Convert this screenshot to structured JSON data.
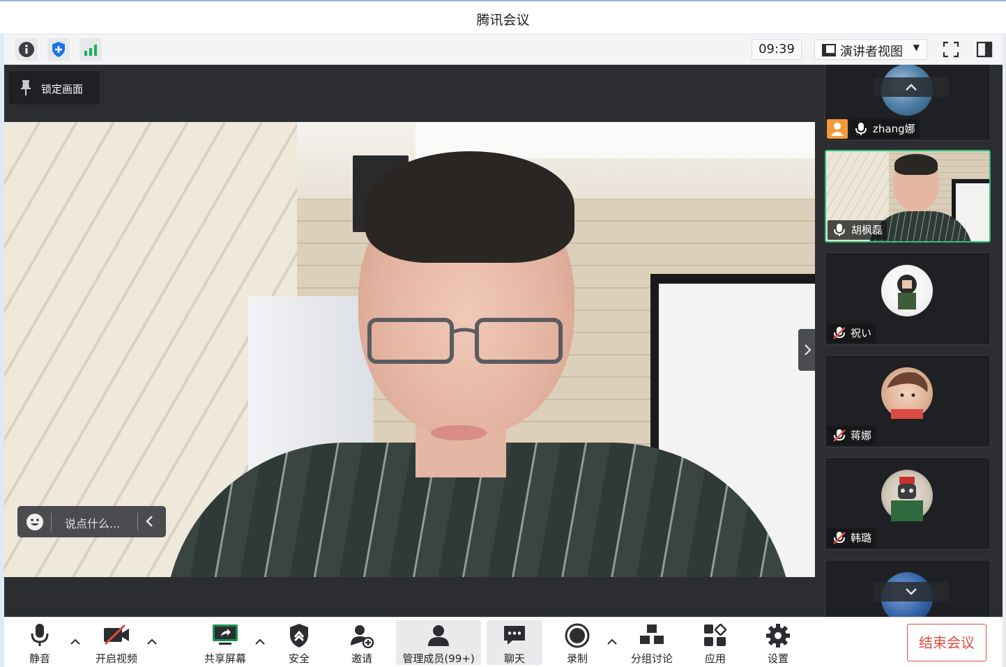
{
  "window": {
    "title": "腾讯会议"
  },
  "toolbar": {
    "icons": [
      "info-icon",
      "shield-icon",
      "signal-icon"
    ],
    "time": "09:39",
    "view_mode": "演讲者视图",
    "right_icons": [
      "fullscreen-icon",
      "sidebar-layout-icon"
    ]
  },
  "stage": {
    "lock_label": "锁定画面",
    "chat_placeholder": "说点什么..."
  },
  "participants": [
    {
      "name": "zhang娜",
      "mic": "on",
      "host": true,
      "avatar": "landscape"
    },
    {
      "name": "胡枫磊",
      "mic": "on",
      "active": true,
      "avatar": "video"
    },
    {
      "name": "祝い",
      "mic": "muted",
      "avatar": "cartoon"
    },
    {
      "name": "蒋娜",
      "mic": "muted",
      "avatar": "child"
    },
    {
      "name": "韩璐",
      "mic": "muted",
      "avatar": "robot"
    }
  ],
  "bottom_bar": {
    "mute": "静音",
    "video": "开启视频",
    "share": "共享屏幕",
    "security": "安全",
    "invite": "邀请",
    "members": "管理成员(99+)",
    "chat": "聊天",
    "record": "录制",
    "breakout": "分组讨论",
    "apps": "应用",
    "settings": "设置",
    "end": "结束会议"
  },
  "colors": {
    "accent_green": "#2ec27e",
    "end_red": "#e5493f",
    "host_orange": "#f39a3c"
  }
}
